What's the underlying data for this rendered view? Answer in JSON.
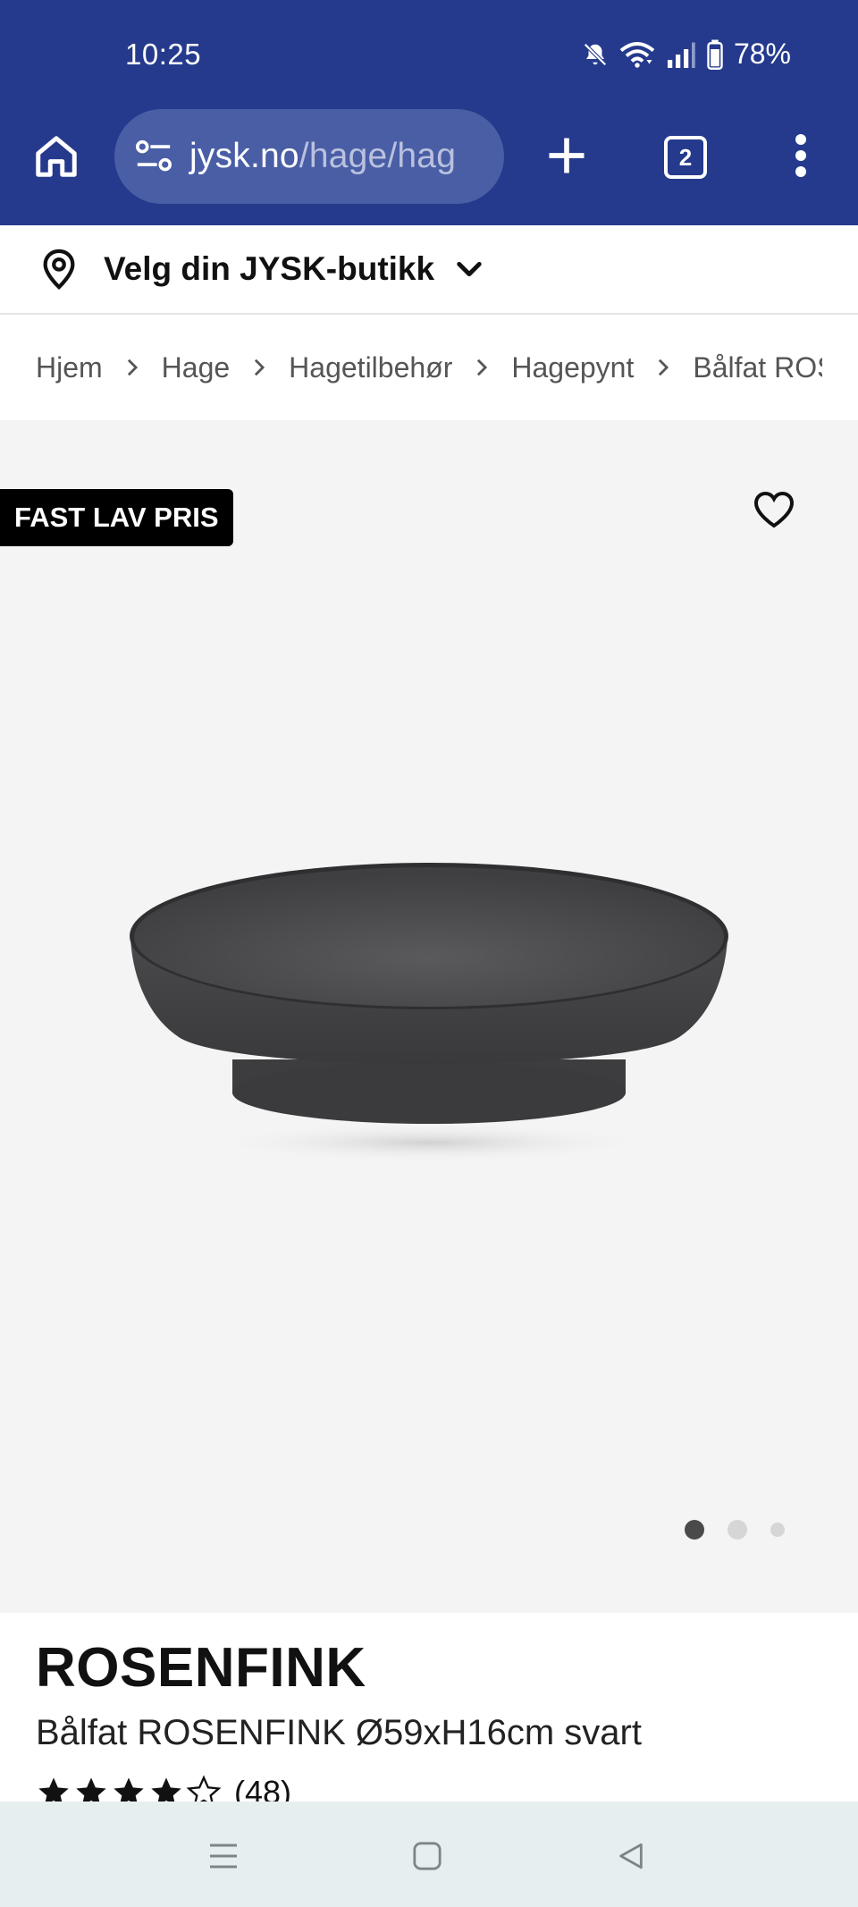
{
  "status_bar": {
    "time": "10:25",
    "battery": "78%",
    "icons": [
      "bell-off-icon",
      "wifi-icon",
      "signal-icon",
      "battery-icon"
    ]
  },
  "browser": {
    "url_host": "jysk.no",
    "url_path": "/hage/hag",
    "tab_count": "2",
    "colors": {
      "toolbar": "#253a8c",
      "url_pill": "#4a5ea6"
    }
  },
  "store_selector": {
    "label": "Velg din JYSK-butikk"
  },
  "breadcrumb": {
    "items": [
      "Hjem",
      "Hage",
      "Hagetilbehør",
      "Hagepynt",
      "Bålfat ROSENFINK"
    ]
  },
  "gallery": {
    "badge": "FAST LAV PRIS",
    "slide_count": 3,
    "active_slide": 1
  },
  "product": {
    "brand": "ROSENFINK",
    "name": "Bålfat ROSENFINK Ø59xH16cm svart",
    "rating": 4.5,
    "rating_max": 5,
    "review_count": "(48)"
  },
  "nav_bar": {
    "buttons": [
      "recents-icon",
      "home-circle-icon",
      "back-icon"
    ]
  }
}
